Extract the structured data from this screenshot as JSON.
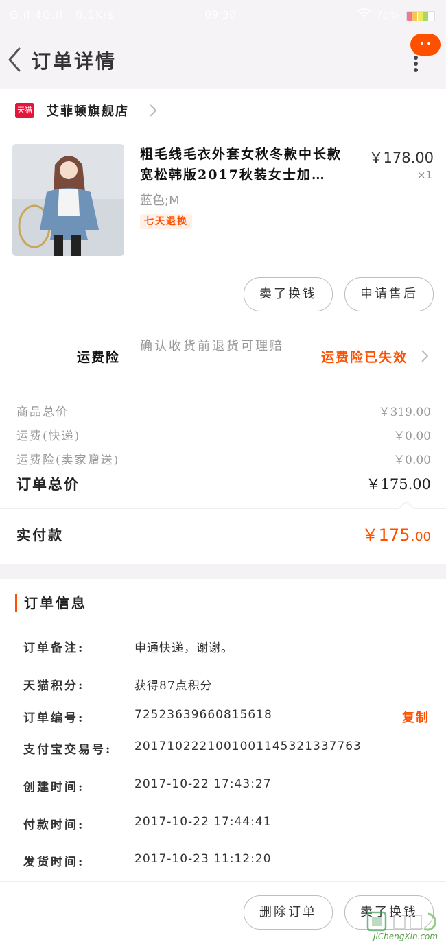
{
  "status_bar": {
    "network": "G.ıl  4G.ıl",
    "speed": "0.1K/s",
    "time": "09:30",
    "battery": "70%"
  },
  "header": {
    "title": "订单详情"
  },
  "shop": {
    "badge": "天猫",
    "name": "艾菲顿旗舰店"
  },
  "product": {
    "title": "粗毛线毛衣外套女秋冬款中长款宽松韩版2017秋装女士加…",
    "price": "￥178.00",
    "quantity": "×1",
    "sku": "蓝色;M",
    "return_tag": "七天退换"
  },
  "actions": {
    "sell_label": "卖了换钱",
    "after_sale_label": "申请售后"
  },
  "insurance": {
    "label": "运费险",
    "description": "确认收货前退货可理赔",
    "status": "运费险已失效"
  },
  "summary": {
    "goods_total_label": "商品总价",
    "goods_total": "￥319.00",
    "shipping_label": "运费(快递)",
    "shipping": "￥0.00",
    "insurance_label": "运费险(卖家赠送)",
    "insurance": "￥0.00",
    "order_total_label": "订单总价",
    "order_total": "￥175.00",
    "paid_label": "实付款",
    "paid_main": "￥175.",
    "paid_decimal": "00"
  },
  "order_info": {
    "title": "订单信息",
    "rows": [
      {
        "key": "订单备注:",
        "value": "申通快递，谢谢。"
      },
      {
        "key": "天猫积分:",
        "value": "获得87点积分"
      },
      {
        "key": "订单编号:",
        "value": "72523639660815618"
      },
      {
        "key": "支付宝交易号:",
        "value": "2017102221001001145321337763"
      },
      {
        "key": "创建时间:",
        "value": "2017-10-22 17:43:27"
      },
      {
        "key": "付款时间:",
        "value": "2017-10-22 17:44:41"
      },
      {
        "key": "发货时间:",
        "value": "2017-10-23 11:12:20"
      }
    ],
    "copy_label": "复制"
  },
  "bottom": {
    "delete_label": "删除订单",
    "sell_label": "卖了换钱"
  },
  "watermark": {
    "text": "JiChengXin.com"
  },
  "colors": {
    "accent": "#ff5000",
    "tmall_red": "#e3153a",
    "header_bg": "#f6f3f6"
  }
}
